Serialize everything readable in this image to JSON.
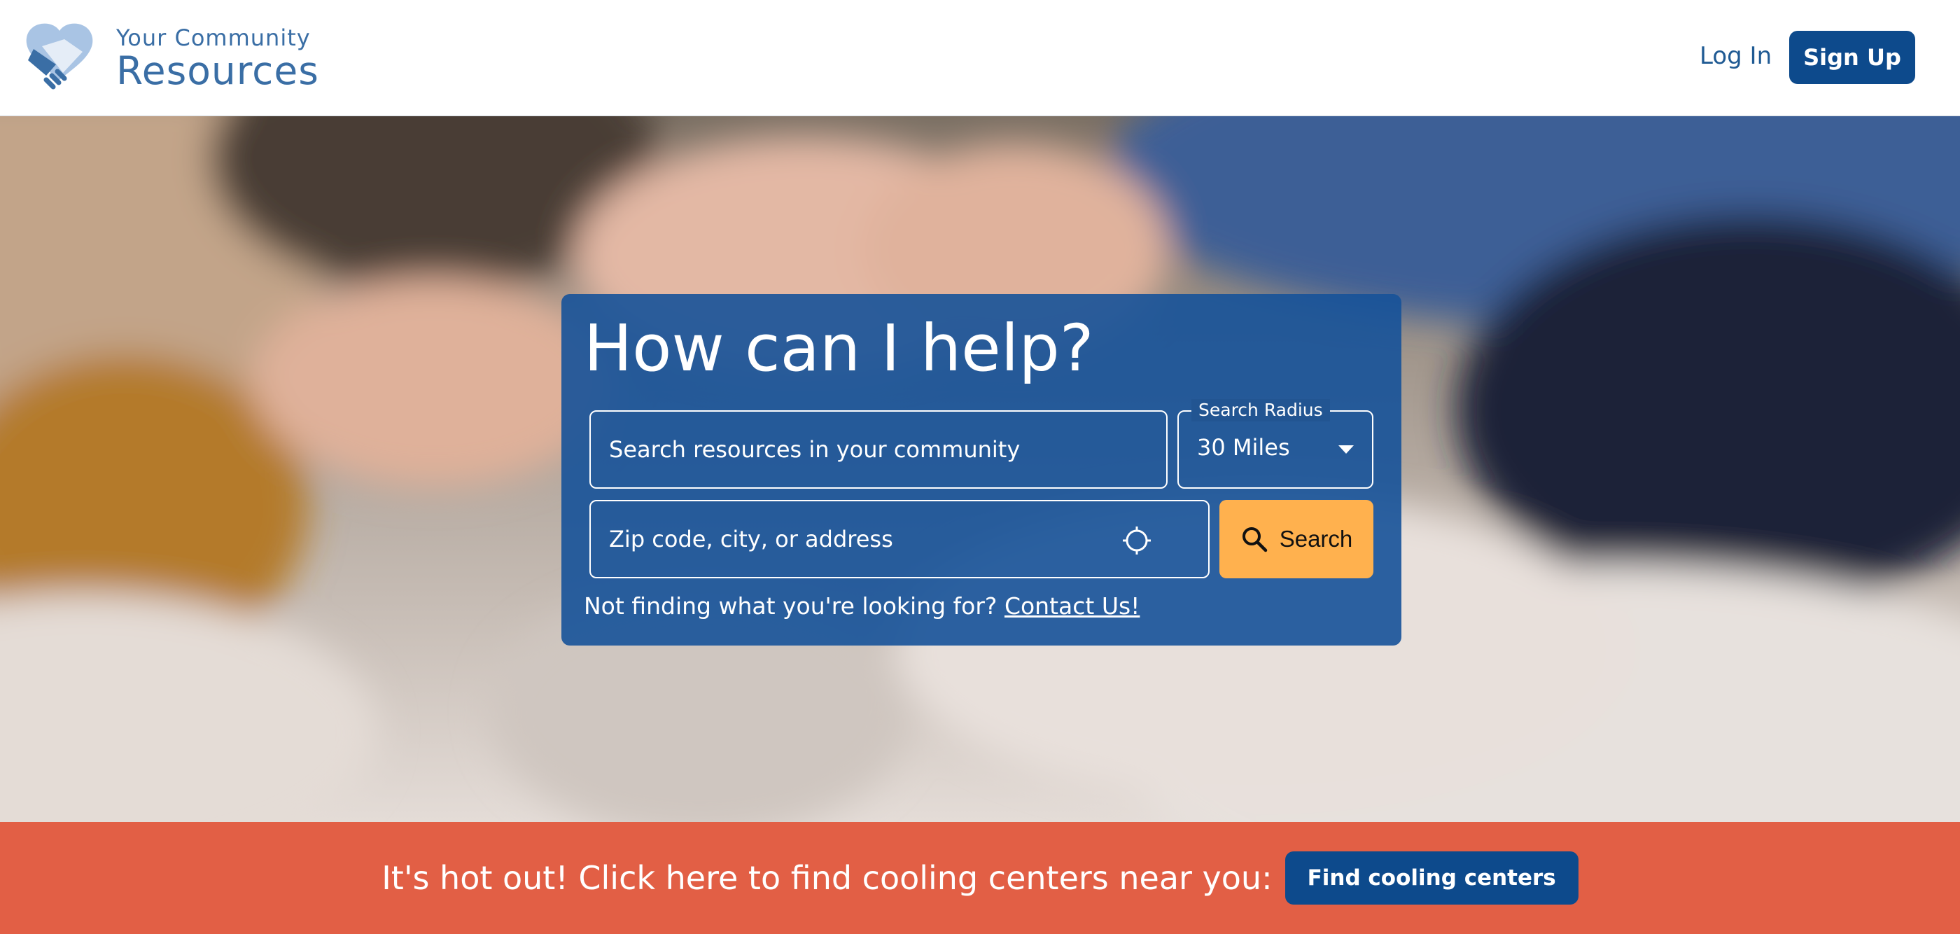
{
  "brand": {
    "line1": "Your Community",
    "line2": "Resources",
    "colors": {
      "primary": "#0d4a8c",
      "brand_text": "#3a6ea5"
    }
  },
  "nav": {
    "login_label": "Log In",
    "signup_label": "Sign Up"
  },
  "hero": {
    "title": "How can I help?",
    "search": {
      "placeholder": "Search resources in your community",
      "value": ""
    },
    "radius": {
      "legend": "Search Radius",
      "selected": "30 Miles"
    },
    "location": {
      "placeholder": "Zip code, city, or address",
      "value": "",
      "icon": "crosshair-icon"
    },
    "search_button": {
      "label": "Search",
      "icon": "search-icon",
      "color": "#ffb14e"
    },
    "helper_text": "Not finding what you're looking for?",
    "contact_link": "Contact Us!",
    "panel_color": "#165299"
  },
  "banner": {
    "text": "It's hot out! Click here to find cooling centers near you:",
    "button_label": "Find cooling centers",
    "color": "#e25f45"
  }
}
